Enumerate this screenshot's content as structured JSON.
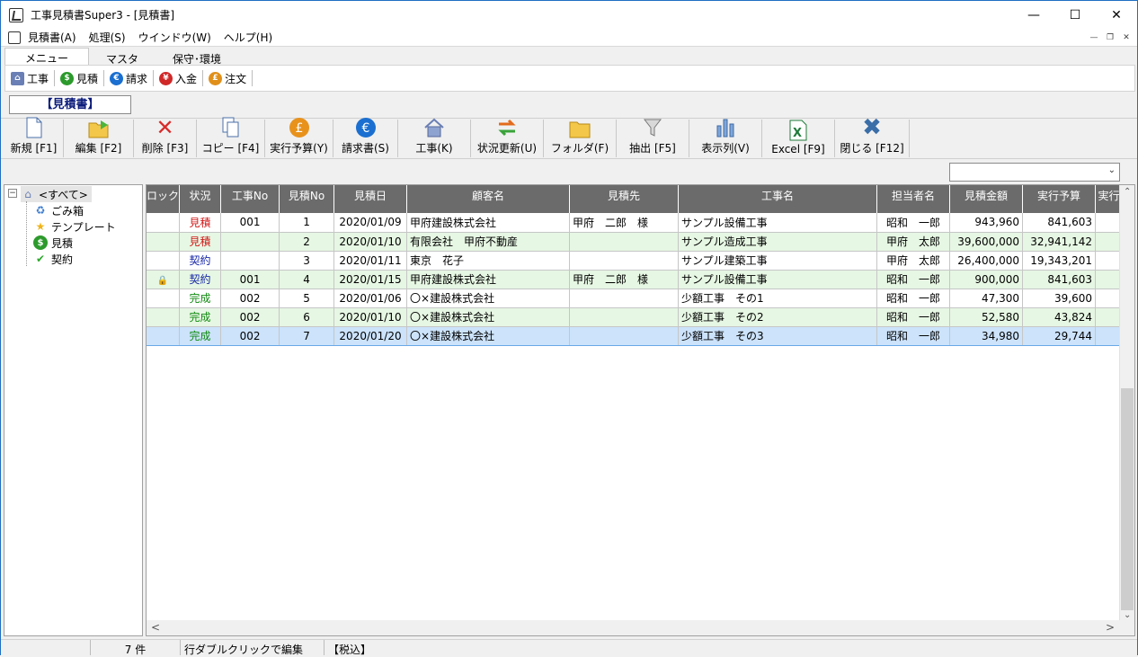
{
  "window": {
    "title": "工事見積書Super3 - [見積書]"
  },
  "menubar": [
    "見積書(A)",
    "処理(S)",
    "ウインドウ(W)",
    "ヘルプ(H)"
  ],
  "tabs": [
    "メニュー",
    "マスタ",
    "保守･環境"
  ],
  "nav": [
    {
      "label": "工事",
      "icon": "house-icon",
      "color": "#6a7fb5"
    },
    {
      "label": "見積",
      "icon": "dollar-coin-icon",
      "color": "#2c9a2c"
    },
    {
      "label": "請求",
      "icon": "euro-coin-icon",
      "color": "#1a6fd0"
    },
    {
      "label": "入金",
      "icon": "yen-coin-icon",
      "color": "#d02828"
    },
    {
      "label": "注文",
      "icon": "pound-coin-icon",
      "color": "#e0901a"
    }
  ],
  "section_title": "【見積書】",
  "toolbar": [
    {
      "label": "新規 [F1]",
      "icon": "new-document-icon"
    },
    {
      "label": "編集 [F2]",
      "icon": "edit-folder-icon"
    },
    {
      "label": "削除 [F3]",
      "icon": "delete-x-icon"
    },
    {
      "label": "コピー [F4]",
      "icon": "copy-icon"
    },
    {
      "label": "実行予算(Y)",
      "icon": "budget-coin-icon"
    },
    {
      "label": "請求書(S)",
      "icon": "invoice-coin-icon"
    },
    {
      "label": "工事(K)",
      "icon": "house-icon"
    },
    {
      "label": "状況更新(U)",
      "icon": "refresh-arrows-icon"
    },
    {
      "label": "フォルダ(F)",
      "icon": "folder-icon"
    },
    {
      "label": "抽出 [F5]",
      "icon": "filter-funnel-icon"
    },
    {
      "label": "表示列(V)",
      "icon": "columns-chart-icon"
    },
    {
      "label": "Excel [F9]",
      "icon": "excel-icon"
    },
    {
      "label": "閉じる [F12]",
      "icon": "close-x-icon"
    }
  ],
  "combo": {
    "value": ""
  },
  "tree": {
    "root": "<すべて>",
    "children": [
      {
        "label": "ごみ箱",
        "icon": "recycle-bin-icon"
      },
      {
        "label": "テンプレート",
        "icon": "star-icon"
      },
      {
        "label": "見積",
        "icon": "dollar-coin-icon"
      },
      {
        "label": "契約",
        "icon": "checkmark-icon"
      }
    ]
  },
  "grid": {
    "columns": [
      "ロック",
      "状況",
      "工事No",
      "見積No",
      "見積日",
      "顧客名",
      "見積先",
      "工事名",
      "担当者名",
      "見積金額",
      "実行予算",
      "実行"
    ],
    "rows": [
      {
        "lock": "",
        "status": "見積",
        "status_color": "red",
        "koji_no": "001",
        "mitsu_no": "1",
        "date": "2020/01/09",
        "customer": "甲府建設株式会社",
        "dest": "甲府　二郎　様",
        "name": "サンプル設備工事",
        "staff": "昭和　一郎",
        "amount": "943,960",
        "budget": "841,603"
      },
      {
        "lock": "",
        "status": "見積",
        "status_color": "red",
        "koji_no": "",
        "mitsu_no": "2",
        "date": "2020/01/10",
        "customer": "有限会社　甲府不動産",
        "dest": "",
        "name": "サンプル造成工事",
        "staff": "甲府　太郎",
        "amount": "39,600,000",
        "budget": "32,941,142"
      },
      {
        "lock": "",
        "status": "契約",
        "status_color": "blue",
        "koji_no": "",
        "mitsu_no": "3",
        "date": "2020/01/11",
        "customer": "東京　花子",
        "dest": "",
        "name": "サンプル建築工事",
        "staff": "甲府　太郎",
        "amount": "26,400,000",
        "budget": "19,343,201"
      },
      {
        "lock": "locked",
        "status": "契約",
        "status_color": "blue",
        "koji_no": "001",
        "mitsu_no": "4",
        "date": "2020/01/15",
        "customer": "甲府建設株式会社",
        "dest": "甲府　二郎　様",
        "name": "サンプル設備工事",
        "staff": "昭和　一郎",
        "amount": "900,000",
        "budget": "841,603"
      },
      {
        "lock": "",
        "status": "完成",
        "status_color": "green",
        "koji_no": "002",
        "mitsu_no": "5",
        "date": "2020/01/06",
        "customer": "〇×建設株式会社",
        "dest": "",
        "name": "少額工事　その1",
        "staff": "昭和　一郎",
        "amount": "47,300",
        "budget": "39,600"
      },
      {
        "lock": "",
        "status": "完成",
        "status_color": "green",
        "koji_no": "002",
        "mitsu_no": "6",
        "date": "2020/01/10",
        "customer": "〇×建設株式会社",
        "dest": "",
        "name": "少額工事　その2",
        "staff": "昭和　一郎",
        "amount": "52,580",
        "budget": "43,824"
      },
      {
        "lock": "",
        "status": "完成",
        "status_color": "green",
        "koji_no": "002",
        "mitsu_no": "7",
        "date": "2020/01/20",
        "customer": "〇×建設株式会社",
        "dest": "",
        "name": "少額工事　その3",
        "staff": "昭和　一郎",
        "amount": "34,980",
        "budget": "29,744"
      }
    ]
  },
  "status": {
    "count": "7 件",
    "hint": "行ダブルクリックで編集",
    "tax": "【税込】"
  }
}
